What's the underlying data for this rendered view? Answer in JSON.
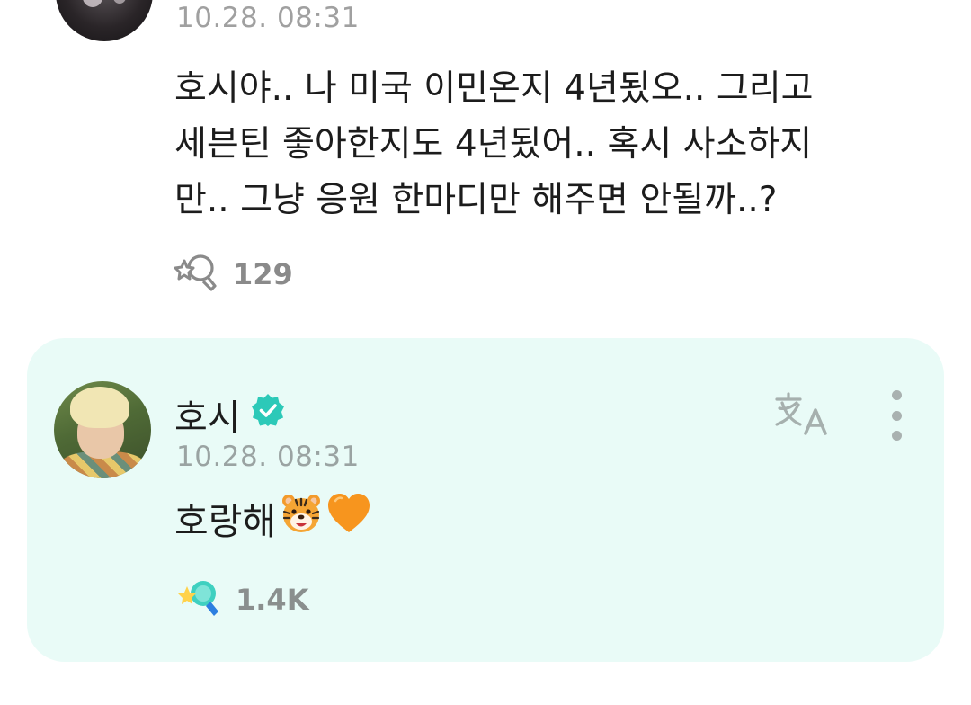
{
  "fan_comment": {
    "timestamp": "10.28. 08:31",
    "text_lines": [
      "호시야.. 나 미국 이민온지 4년됬오.. 그리고",
      "세븐틴 좋아한지도 4년됬어.. 혹시 사소하지",
      "만.. 그냥 응원 한마디만 해주면 안될까..?"
    ],
    "cheer_count": "129",
    "cheer_icon": "cheer-outline-icon"
  },
  "artist_reply": {
    "name": "호시",
    "verified_icon": "verified-badge-icon",
    "timestamp": "10.28. 08:31",
    "text": "호랑해",
    "emojis": [
      "tiger-face-emoji",
      "orange-heart-emoji"
    ],
    "cheer_count": "1.4K",
    "cheer_icon": "cheer-filled-icon",
    "translate_icon": "translate-icon",
    "more_icon": "more-vertical-icon",
    "colors": {
      "card_background": "#e9fbf7",
      "verified": "#2cc9b8",
      "accent": "#3fd0c0"
    }
  }
}
